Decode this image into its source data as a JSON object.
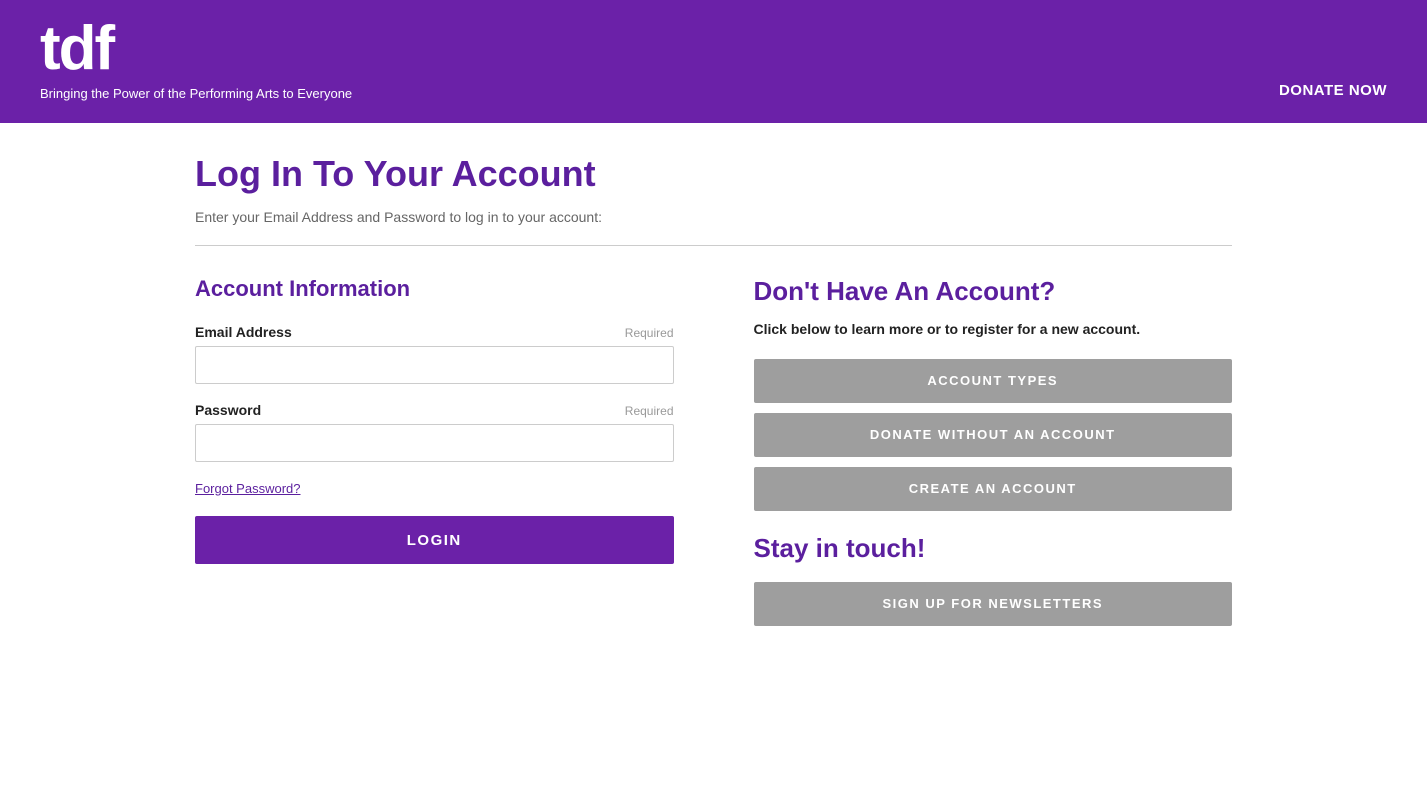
{
  "header": {
    "logo": "tdf",
    "tagline": "Bringing the Power of the Performing Arts to Everyone",
    "donate_now": "DONATE NOW"
  },
  "page": {
    "title": "Log In To Your Account",
    "subtitle": "Enter your Email Address and Password to log in to your account:"
  },
  "left": {
    "section_title": "Account Information",
    "email_label": "Email Address",
    "email_required": "Required",
    "email_placeholder": "",
    "password_label": "Password",
    "password_required": "Required",
    "password_placeholder": "",
    "forgot_password": "Forgot Password?",
    "login_button": "LOGIN"
  },
  "right": {
    "section_title": "Don't Have An Account?",
    "subtitle": "Click below to learn more or to register for a new account.",
    "account_types_button": "ACCOUNT TYPES",
    "donate_without_account_button": "DONATE WITHOUT AN ACCOUNT",
    "create_account_button": "CREATE AN ACCOUNT",
    "stay_in_touch_title": "Stay in touch!",
    "newsletter_button": "SIGN UP FOR NEWSLETTERS"
  }
}
